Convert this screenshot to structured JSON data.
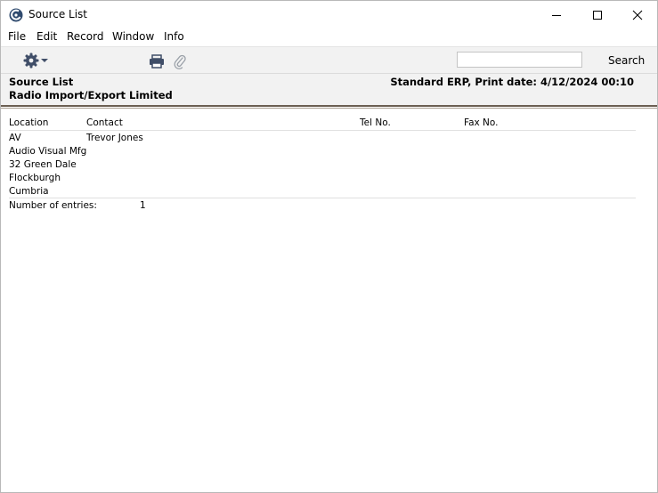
{
  "window": {
    "title": "Source List"
  },
  "menu": {
    "items": [
      "File",
      "Edit",
      "Record",
      "Window",
      "Info"
    ]
  },
  "toolbar": {
    "search_value": "",
    "search_label": "Search"
  },
  "report": {
    "title": "Source List",
    "company": "Radio Import/Export Limited",
    "right_header": "Standard ERP, Print date: 4/12/2024 00:10",
    "columns": {
      "location": "Location",
      "contact": "Contact",
      "tel": "Tel No.",
      "fax": "Fax No."
    },
    "entry": {
      "location": "AV",
      "contact": "Trevor Jones",
      "address": [
        "Audio Visual Mfg",
        "32 Green Dale",
        "Flockburgh",
        "Cumbria"
      ]
    },
    "count_label": "Number of entries:",
    "count_value": "1"
  },
  "colors": {
    "toolbar_bg": "#f2f2f2",
    "icon_blue": "#404e68",
    "separator": "#6b5f52"
  },
  "icons": [
    "app-logo-icon",
    "minimize-icon",
    "maximize-icon",
    "close-icon",
    "gear-icon",
    "printer-icon",
    "paperclip-icon"
  ]
}
